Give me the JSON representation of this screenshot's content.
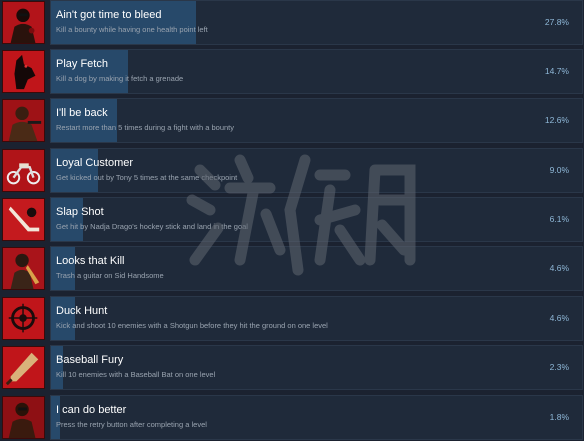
{
  "achievements": [
    {
      "title": "Ain't got time to bleed",
      "description": "Kill a bounty while having one health point left",
      "percent_label": "27.8%",
      "percent": 27.8,
      "icon": "bleeding-gunman-icon"
    },
    {
      "title": "Play Fetch",
      "description": "Kill a dog by making it fetch a grenade",
      "percent_label": "14.7%",
      "percent": 14.7,
      "icon": "doberman-dog-icon"
    },
    {
      "title": "I'll be back",
      "description": "Restart more than 5 times during a fight with a bounty",
      "percent_label": "12.6%",
      "percent": 12.6,
      "icon": "mercenary-icon"
    },
    {
      "title": "Loyal Customer",
      "description": "Get kicked out by Tony 5 times at the same checkpoint",
      "percent_label": "9.0%",
      "percent": 9.0,
      "icon": "motorcycle-icon"
    },
    {
      "title": "Slap Shot",
      "description": "Get hit by Nadja Drago's hockey stick and land in the goal",
      "percent_label": "6.1%",
      "percent": 6.1,
      "icon": "hockey-stick-icon"
    },
    {
      "title": "Looks that Kill",
      "description": "Trash a guitar on Sid Handsome",
      "percent_label": "4.6%",
      "percent": 4.6,
      "icon": "rockstar-icon"
    },
    {
      "title": "Duck Hunt",
      "description": "Kick and shoot 10 enemies with a Shotgun before they hit the ground on one level",
      "percent_label": "4.6%",
      "percent": 4.6,
      "icon": "duck-target-icon"
    },
    {
      "title": "Baseball Fury",
      "description": "Kill 10 enemies with a Baseball Bat on one level",
      "percent_label": "2.3%",
      "percent": 2.3,
      "icon": "baseball-bat-icon"
    },
    {
      "title": "I can do better",
      "description": "Press the retry button after completing a level",
      "percent_label": "1.8%",
      "percent": 1.8,
      "icon": "retry-gunman-icon"
    }
  ],
  "watermark": {
    "text": "游侠网"
  },
  "colors": {
    "background": "#1b2230",
    "card": "#1f2a3a",
    "bar": "#27496a",
    "title": "#ffffff",
    "description": "#9aa4b0",
    "percent": "#8fb8d8",
    "icon_red": "#c0151a"
  }
}
